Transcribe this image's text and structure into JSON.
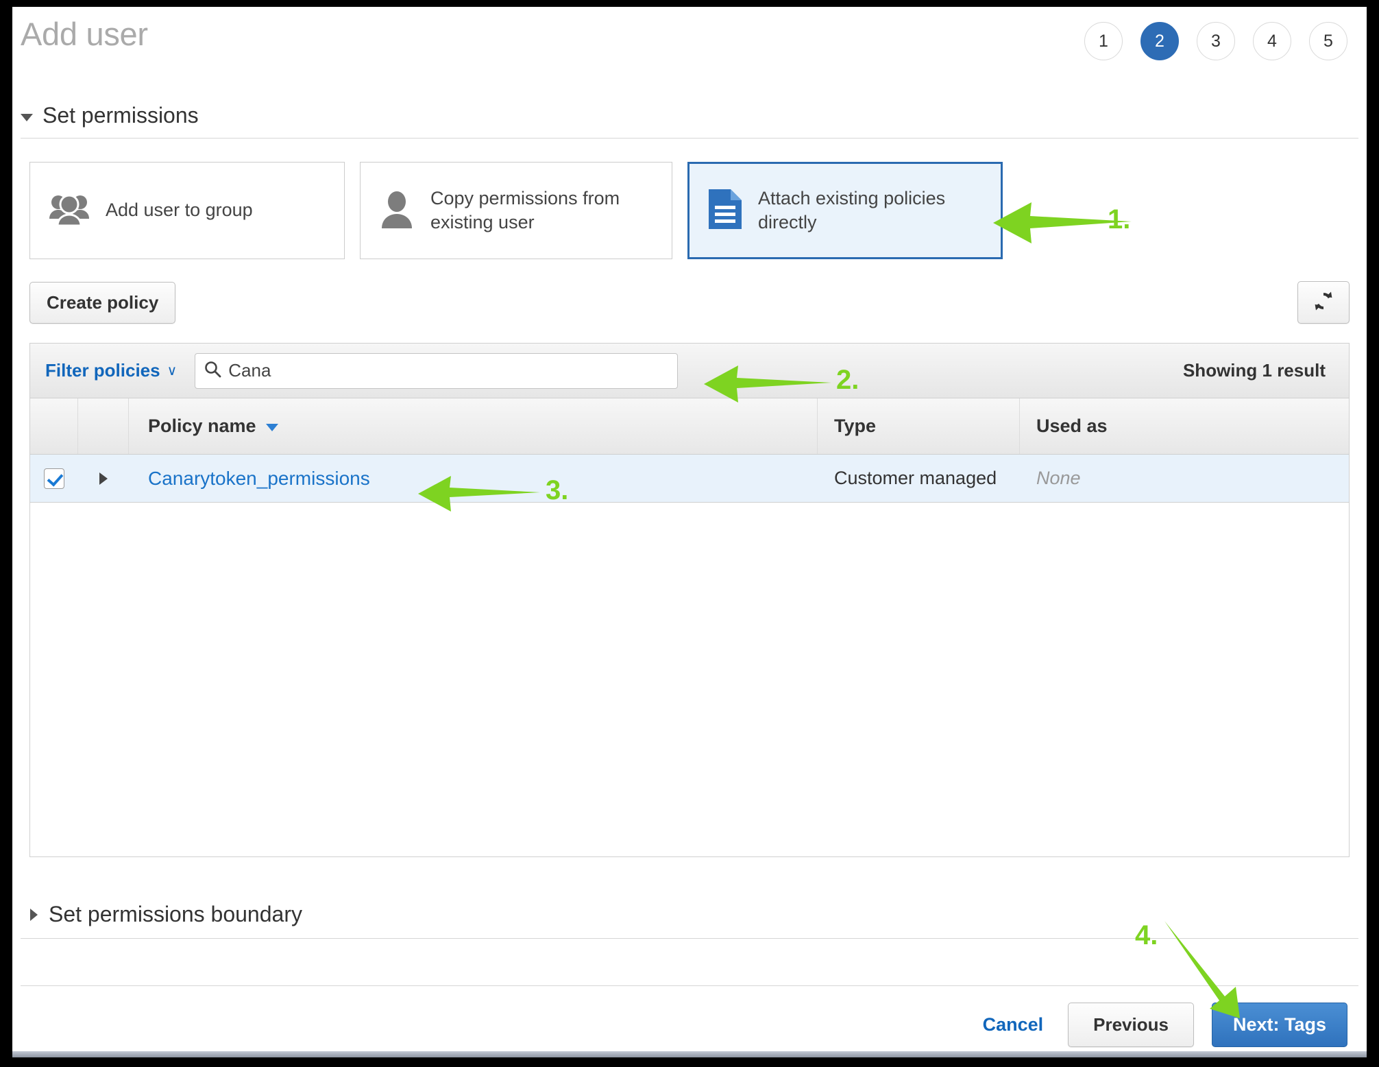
{
  "header": {
    "title": "Add user",
    "steps": [
      {
        "label": "1",
        "active": false
      },
      {
        "label": "2",
        "active": true
      },
      {
        "label": "3",
        "active": false
      },
      {
        "label": "4",
        "active": false
      },
      {
        "label": "5",
        "active": false
      }
    ]
  },
  "permissions": {
    "section_title": "Set permissions",
    "options": [
      {
        "label": "Add user to group",
        "icon": "users-group-icon",
        "selected": false
      },
      {
        "label": "Copy permissions from existing user",
        "icon": "user-icon",
        "selected": false
      },
      {
        "label": "Attach existing policies directly",
        "icon": "document-icon",
        "selected": true
      }
    ],
    "create_policy_label": "Create policy",
    "refresh_icon": "refresh-icon"
  },
  "filter": {
    "filter_label": "Filter policies",
    "chevron": "∨",
    "search_value": "Cana",
    "search_placeholder": "Search",
    "search_icon": "search-icon",
    "showing_text": "Showing 1 result"
  },
  "table": {
    "columns": [
      "Policy name",
      "Type",
      "Used as"
    ],
    "sort_column": "Policy name",
    "rows": [
      {
        "checked": true,
        "name": "Canarytoken_permissions",
        "type": "Customer managed",
        "used_as": "None"
      }
    ]
  },
  "boundary": {
    "title": "Set permissions boundary"
  },
  "footer": {
    "cancel_label": "Cancel",
    "previous_label": "Previous",
    "next_label": "Next: Tags"
  },
  "annotations": [
    {
      "id": "1",
      "label": "1.",
      "target": "attach-existing-policies-card",
      "direction": "left"
    },
    {
      "id": "2",
      "label": "2.",
      "target": "policy-search-input",
      "direction": "left"
    },
    {
      "id": "3",
      "label": "3.",
      "target": "policy-name-link",
      "direction": "left"
    },
    {
      "id": "4",
      "label": "4.",
      "target": "next-tags-button",
      "direction": "down-right"
    }
  ],
  "colors": {
    "accent_blue": "#2d6cb5",
    "link_blue": "#1166bb",
    "annotation_green": "#7ed321",
    "selected_row": "#e8f2fb",
    "frame_black": "#000000"
  }
}
